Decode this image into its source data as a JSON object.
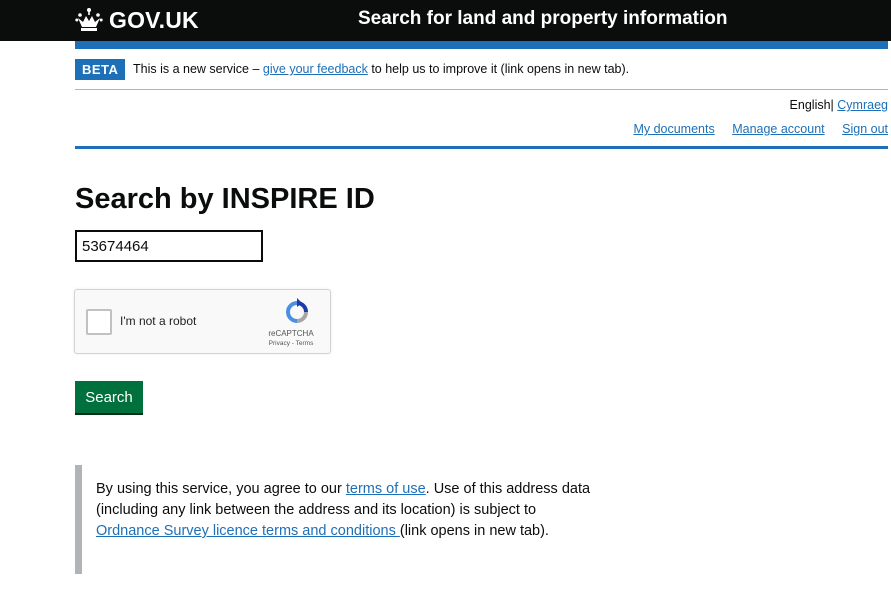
{
  "header": {
    "logo_text": "GOV.UK",
    "service_name": "Search for land and property information"
  },
  "phase_banner": {
    "tag": "BETA",
    "text_before": "This is a new service – ",
    "feedback_link": "give your feedback",
    "text_after": " to help us to improve it (link opens in new tab)."
  },
  "language": {
    "current": "English",
    "separator": "|",
    "alternate": "Cymraeg"
  },
  "account_nav": {
    "my_documents": "My documents",
    "manage_account": "Manage account",
    "sign_out": "Sign out"
  },
  "main": {
    "title": "Search by INSPIRE ID",
    "inspire_id_value": "53674464",
    "search_button": "Search"
  },
  "recaptcha": {
    "label": "I'm not a robot",
    "brand": "reCAPTCHA",
    "terms": "Privacy - Terms"
  },
  "notice": {
    "part1": "By using this service, you agree to our ",
    "terms_link": "terms of use",
    "part2": ". Use of this address data (including any link between the address and its location) is subject to ",
    "os_link": "Ordnance Survey licence terms and conditions ",
    "part3": "(link opens in new tab)."
  },
  "colors": {
    "header_bg": "#0b0c0c",
    "brand_blue": "#1d70b8",
    "button_green": "#00703c",
    "inset_border": "#b1b4b6"
  },
  "icons": [
    "crown-icon",
    "recaptcha-logo-icon"
  ]
}
